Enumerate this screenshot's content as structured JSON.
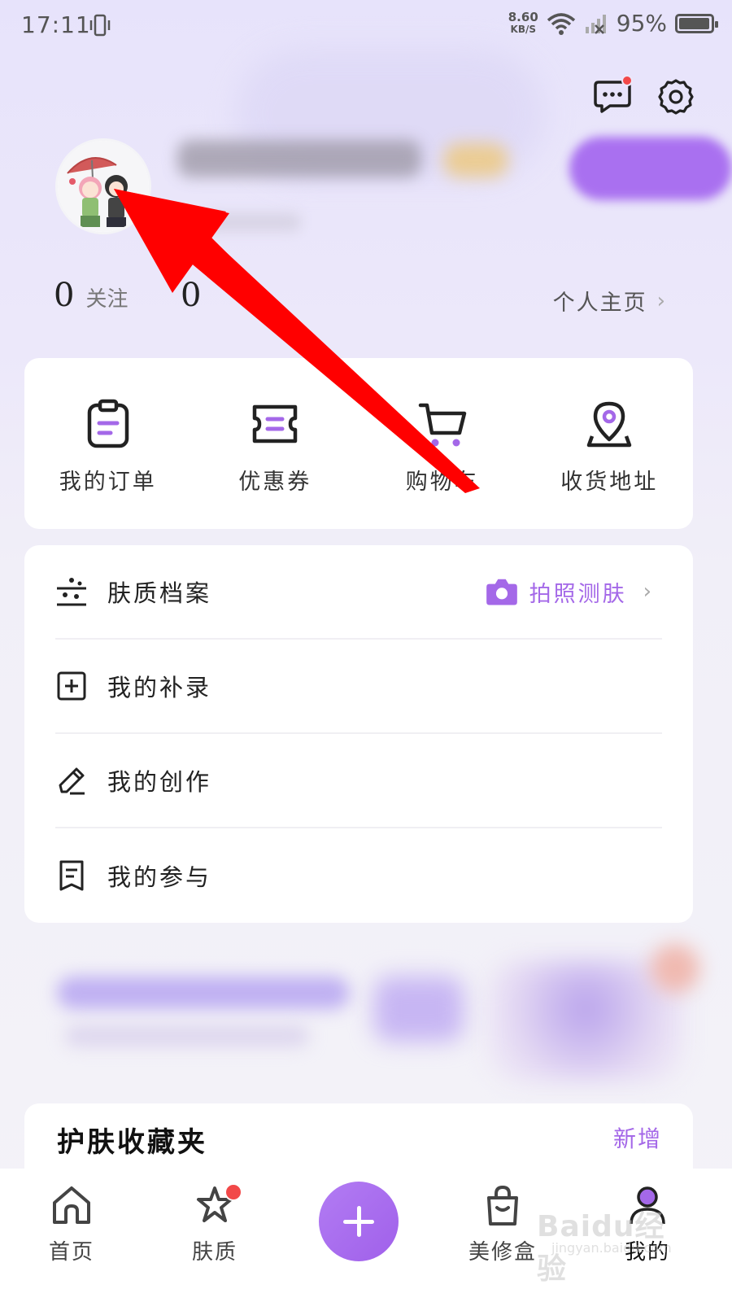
{
  "status_bar": {
    "time": "17:11",
    "speed_value": "8.60",
    "speed_unit": "KB/S",
    "battery": "95%"
  },
  "profile": {
    "following_count": "0",
    "following_label": "关注",
    "followers_count": "0",
    "homepage_link": "个人主页"
  },
  "orders": [
    {
      "label": "我的订单",
      "icon": "order-clipboard-icon"
    },
    {
      "label": "优惠券",
      "icon": "coupon-ticket-icon"
    },
    {
      "label": "购物车",
      "icon": "shopping-cart-icon"
    },
    {
      "label": "收货地址",
      "icon": "location-pin-icon"
    }
  ],
  "menu": [
    {
      "label": "肤质档案",
      "action": "拍照测肤",
      "icon": "skin-profile-icon"
    },
    {
      "label": "我的补录",
      "icon": "add-square-icon"
    },
    {
      "label": "我的创作",
      "icon": "pencil-icon"
    },
    {
      "label": "我的参与",
      "icon": "bookmark-list-icon"
    }
  ],
  "favorites": {
    "title": "护肤收藏夹",
    "add_label": "新增"
  },
  "tabbar": [
    {
      "label": "首页",
      "icon": "home-icon"
    },
    {
      "label": "肤质",
      "icon": "skin-star-icon"
    },
    {
      "label": "",
      "icon": "plus-icon"
    },
    {
      "label": "美修盒",
      "icon": "shopping-bag-icon"
    },
    {
      "label": "我的",
      "icon": "user-icon"
    }
  ],
  "watermark": {
    "text": "Baidu经验",
    "sub": "jingyan.baidu.com"
  },
  "colors": {
    "accent": "#a468e8",
    "badge": "#f24848",
    "annotation_arrow": "#ff0000"
  }
}
